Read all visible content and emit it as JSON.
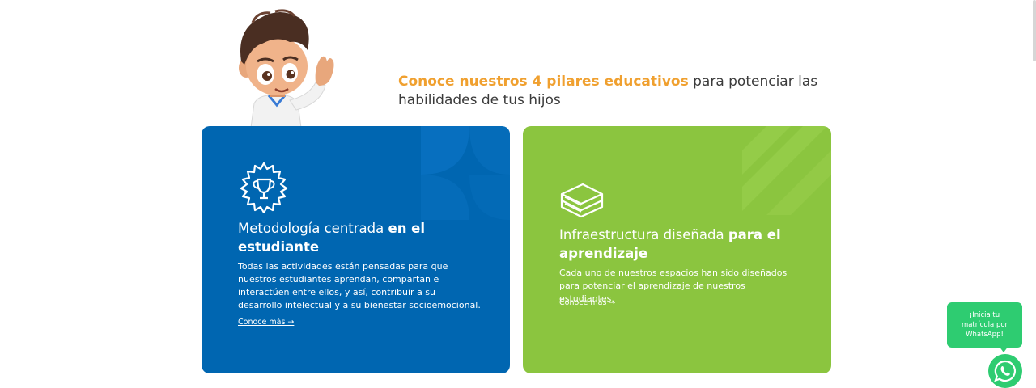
{
  "heading": {
    "accent": "Conoce nuestros 4 pilares educativos",
    "rest": " para potenciar las habilidades de tus hijos"
  },
  "cards": [
    {
      "title_normal": "Metodología centrada ",
      "title_bold": "en el estudiante",
      "text": "Todas las actividades están pensadas para que nuestros estudiantes aprendan, compartan e interactúen entre ellos, y así, contribuir a su desarrollo intelectual y a su bienestar socioemocional.",
      "link": "Conoce más →",
      "icon": "trophy-badge-icon",
      "color": "#0066b1"
    },
    {
      "title_normal": "Infraestructura diseñada ",
      "title_bold": "para el aprendizaje",
      "text": "Cada uno de nuestros espacios han sido diseñados para potenciar el aprendizaje de nuestros estudiantes.",
      "link": "Conoce más →",
      "icon": "books-icon",
      "color": "#8bc53f"
    }
  ],
  "whatsapp": {
    "bubble": "¡Inicia tu matrícula por WhatsApp!",
    "icon": "whatsapp-icon",
    "color": "#2ecc71"
  },
  "colors": {
    "accent": "#f0a02f",
    "text": "#3b3b3b"
  }
}
